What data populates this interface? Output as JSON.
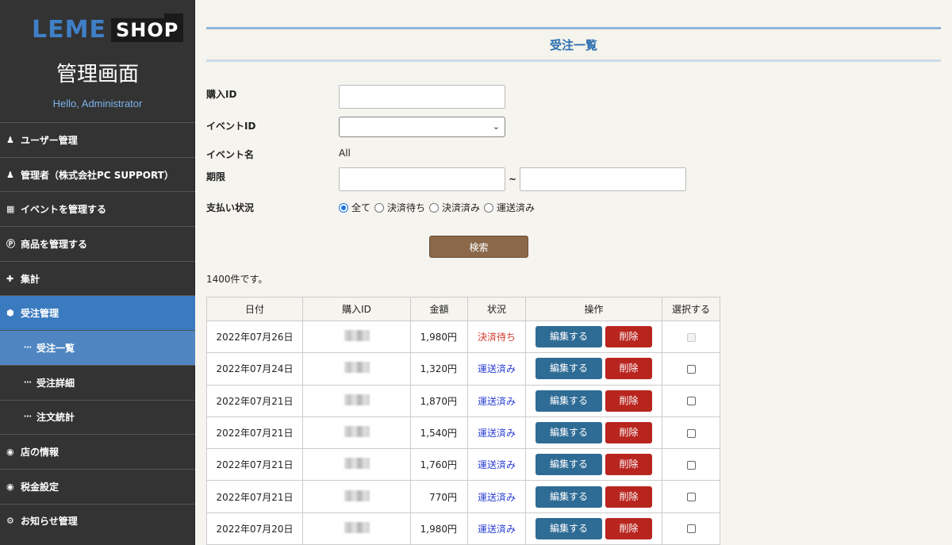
{
  "sidebar": {
    "logo_leme": "LEME",
    "logo_shop": "SHOP",
    "title": "管理画面",
    "greeting": "Hello, Administrator",
    "items": [
      {
        "label": "ユーザー管理",
        "icon": "user-icon"
      },
      {
        "label": "管理者（株式会社PC SUPPORT）",
        "icon": "user-icon"
      },
      {
        "label": "イベントを管理する",
        "icon": "calendar-icon"
      },
      {
        "label": "商品を管理する",
        "icon": "product-p-icon"
      },
      {
        "label": "集計",
        "icon": "plus-icon"
      },
      {
        "label": "受注管理",
        "icon": "cube-icon",
        "active": true
      },
      {
        "label": "受注一覧",
        "icon": "ellipsis-icon",
        "sub": true,
        "active": true
      },
      {
        "label": "受注詳細",
        "icon": "ellipsis-icon",
        "sub": true
      },
      {
        "label": "注文統計",
        "icon": "ellipsis-icon",
        "sub": true
      },
      {
        "label": "店の情報",
        "icon": "user-circle-icon"
      },
      {
        "label": "税金設定",
        "icon": "user-circle-icon"
      },
      {
        "label": "お知らせ管理",
        "icon": "gear-icon"
      }
    ]
  },
  "page": {
    "title": "受注一覧"
  },
  "form": {
    "purchase_id_label": "購入ID",
    "purchase_id_value": "",
    "event_id_label": "イベントID",
    "event_id_value": "",
    "event_name_label": "イベント名",
    "event_name_value": "All",
    "period_label": "期限",
    "period_separator": "~",
    "period_from": "",
    "period_to": "",
    "payment_label": "支払い状況",
    "payment_options": [
      {
        "label": "全て",
        "checked": true
      },
      {
        "label": "決済待ち",
        "checked": false
      },
      {
        "label": "決済済み",
        "checked": false
      },
      {
        "label": "運送済み",
        "checked": false
      }
    ],
    "search_button": "検索"
  },
  "result": {
    "count_text": "1400件です。"
  },
  "table": {
    "headers": [
      "日付",
      "購入ID",
      "金額",
      "状況",
      "操作",
      "選択する"
    ],
    "edit_label": "編集する",
    "delete_label": "削除",
    "rows": [
      {
        "date": "2022年07月26日",
        "amount": "1,980円",
        "status": "決済待ち",
        "status_type": "wait",
        "checkbox_disabled": true
      },
      {
        "date": "2022年07月24日",
        "amount": "1,320円",
        "status": "運送済み",
        "status_type": "ship",
        "checkbox_disabled": false
      },
      {
        "date": "2022年07月21日",
        "amount": "1,870円",
        "status": "運送済み",
        "status_type": "ship",
        "checkbox_disabled": false
      },
      {
        "date": "2022年07月21日",
        "amount": "1,540円",
        "status": "運送済み",
        "status_type": "ship",
        "checkbox_disabled": false
      },
      {
        "date": "2022年07月21日",
        "amount": "1,760円",
        "status": "運送済み",
        "status_type": "ship",
        "checkbox_disabled": false
      },
      {
        "date": "2022年07月21日",
        "amount": "770円",
        "status": "運送済み",
        "status_type": "ship",
        "checkbox_disabled": false
      },
      {
        "date": "2022年07月20日",
        "amount": "1,980円",
        "status": "運送済み",
        "status_type": "ship",
        "checkbox_disabled": false
      }
    ]
  },
  "colors": {
    "sidebar_bg": "#333333",
    "accent_blue": "#3a7abf",
    "edit_button": "#2f6c95",
    "delete_button": "#b8251f",
    "search_button": "#8a6849",
    "status_wait": "#d23a2a",
    "status_ship": "#2a3ed2"
  }
}
